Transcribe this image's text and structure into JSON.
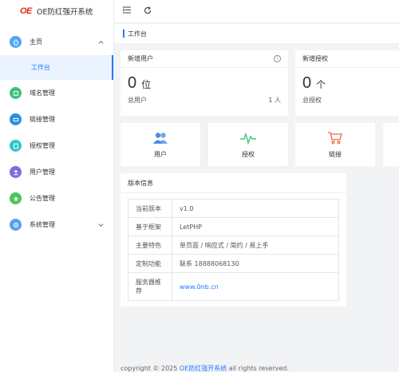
{
  "brand": {
    "logo": "OE",
    "name": "OE防红强开系统"
  },
  "sidebar": {
    "items": [
      {
        "label": "主页",
        "icon": "home-icon",
        "color": "#4ea6f5",
        "chevron": "⌃"
      },
      {
        "label": "域名管理",
        "icon": "domain-icon",
        "color": "#3cc47c"
      },
      {
        "label": "链接管理",
        "icon": "link-icon",
        "color": "#2a8fe0"
      },
      {
        "label": "授权管理",
        "icon": "auth-icon",
        "color": "#2ec7c9"
      },
      {
        "label": "用户管理",
        "icon": "user-icon",
        "color": "#7b6fe0"
      },
      {
        "label": "公告管理",
        "icon": "notice-icon",
        "color": "#4cc45a"
      },
      {
        "label": "系统管理",
        "icon": "gear-icon",
        "color": "#5aa0f0",
        "chevron": "⌄"
      }
    ],
    "submenu": {
      "label": "工作台"
    }
  },
  "header": {
    "menu_icon": "☰",
    "refresh_icon": "↻"
  },
  "tabs": {
    "active": "工作台"
  },
  "stats": [
    {
      "title": "新增用户",
      "value": "0",
      "unit": "位",
      "foot_label": "总用户",
      "foot_value": "1 人",
      "info": "i"
    },
    {
      "title": "新增授权",
      "value": "0",
      "unit": "个",
      "foot_label": "总授权",
      "foot_value": ""
    }
  ],
  "quick_links": [
    {
      "label": "用户",
      "icon": "users-icon",
      "color": "#4a90e2"
    },
    {
      "label": "授权",
      "icon": "pulse-icon",
      "color": "#3cc47c"
    },
    {
      "label": "链接",
      "icon": "cart-icon",
      "color": "#f5673a"
    }
  ],
  "version": {
    "title": "版本信息",
    "rows": [
      {
        "key": "当前版本",
        "value": "v1.0"
      },
      {
        "key": "基于框架",
        "value": "LetPHP"
      },
      {
        "key": "主要特色",
        "value": "单页面 / 响应式 / 简约 / 易上手"
      },
      {
        "key": "定制功能",
        "value": "联系 18888068130"
      },
      {
        "key": "服务器推荐",
        "value": "www.0nb.cn"
      }
    ]
  },
  "footer": {
    "prefix": "copyright © 2025 ",
    "brand": "OE防红强开系统",
    "suffix": " all rights reserved."
  }
}
